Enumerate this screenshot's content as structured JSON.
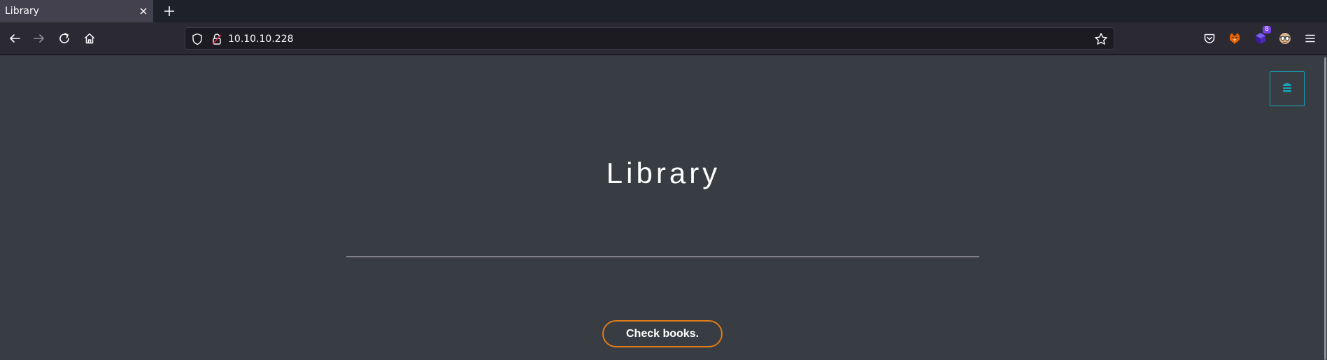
{
  "browser": {
    "tab": {
      "title": "Library"
    },
    "address_bar": {
      "url": "10.10.10.228"
    },
    "extensions": {
      "badge_count": "8"
    }
  },
  "page": {
    "heading": "Library",
    "check_button_label": "Check books."
  },
  "colors": {
    "page_background": "#383c43",
    "accent_teal": "#16a3b8",
    "button_border_orange": "#e07a18"
  },
  "icons": [
    "close-icon",
    "plus-icon",
    "back-arrow-icon",
    "forward-arrow-icon",
    "reload-icon",
    "home-icon",
    "shield-icon",
    "lock-icon",
    "star-icon",
    "pocket-icon",
    "fox-extension-icon",
    "cube-extension-icon",
    "spy-extension-icon",
    "hamburger-menu-icon",
    "menu-toggle-icon"
  ]
}
